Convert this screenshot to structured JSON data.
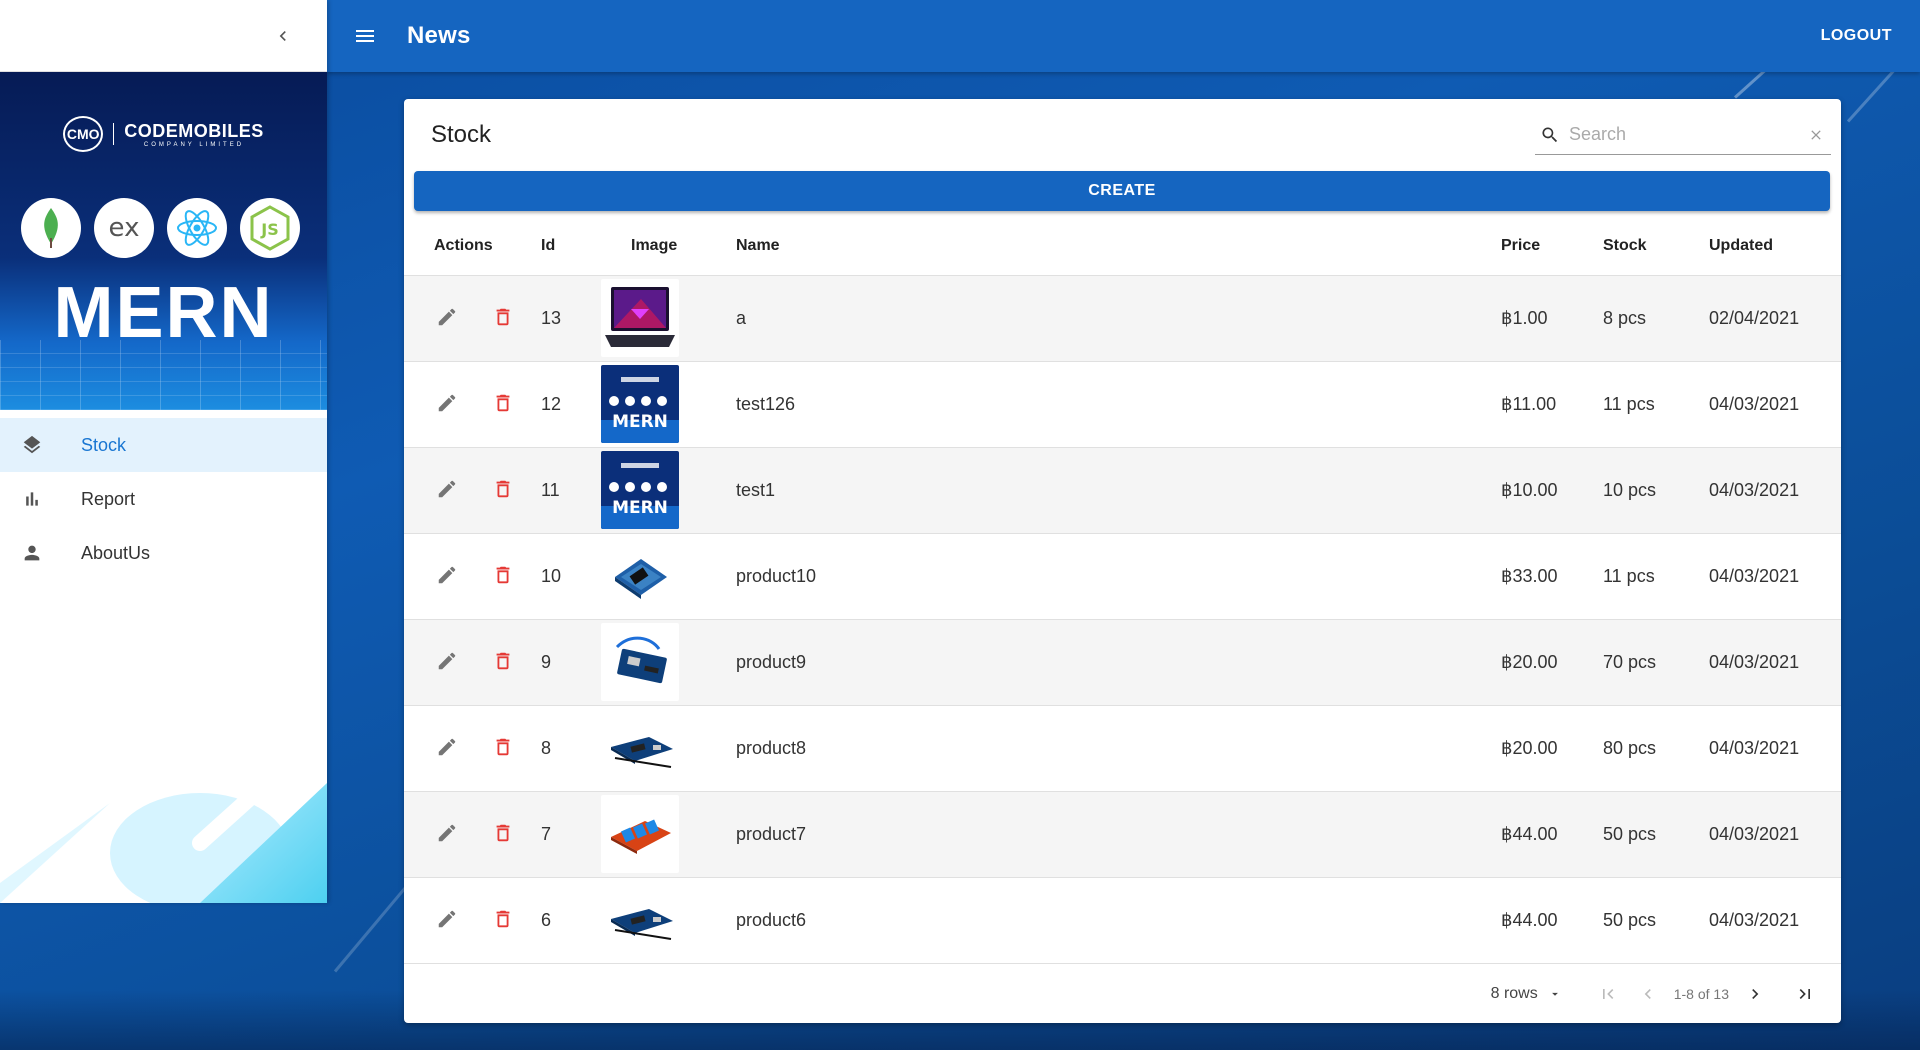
{
  "app": {
    "title": "News",
    "logout_label": "LOGOUT"
  },
  "drawer": {
    "brand": {
      "mark": "CMO",
      "name": "CODEMOBILES",
      "subtitle": "COMPANY LIMITED"
    },
    "banner_word": "MERN",
    "tech_icons": [
      "mongodb-icon",
      "express-icon",
      "react-icon",
      "nodejs-icon"
    ],
    "items": [
      {
        "label": "Stock",
        "icon": "layers-icon",
        "active": true
      },
      {
        "label": "Report",
        "icon": "bar-chart-icon",
        "active": false
      },
      {
        "label": "AboutUs",
        "icon": "person-icon",
        "active": false
      }
    ]
  },
  "stock": {
    "title": "Stock",
    "search": {
      "placeholder": "Search",
      "value": ""
    },
    "create_label": "CREATE",
    "columns": [
      "Actions",
      "Id",
      "Image",
      "Name",
      "Price",
      "Stock",
      "Updated"
    ],
    "rows": [
      {
        "id": "13",
        "image": "laptop",
        "name": "a",
        "price": "฿1.00",
        "stock": "8 pcs",
        "updated": "02/04/2021"
      },
      {
        "id": "12",
        "image": "mern-banner",
        "name": "test126",
        "price": "฿11.00",
        "stock": "11 pcs",
        "updated": "04/03/2021"
      },
      {
        "id": "11",
        "image": "mern-banner",
        "name": "test1",
        "price": "฿10.00",
        "stock": "10 pcs",
        "updated": "04/03/2021"
      },
      {
        "id": "10",
        "image": "sensor-shield",
        "name": "product10",
        "price": "฿33.00",
        "stock": "11 pcs",
        "updated": "04/03/2021"
      },
      {
        "id": "9",
        "image": "arduino-usb",
        "name": "product9",
        "price": "฿20.00",
        "stock": "70 pcs",
        "updated": "04/03/2021"
      },
      {
        "id": "8",
        "image": "arduino-board",
        "name": "product8",
        "price": "฿20.00",
        "stock": "80 pcs",
        "updated": "04/03/2021"
      },
      {
        "id": "7",
        "image": "relay-module",
        "name": "product7",
        "price": "฿44.00",
        "stock": "50 pcs",
        "updated": "04/03/2021"
      },
      {
        "id": "6",
        "image": "arduino-board",
        "name": "product6",
        "price": "฿44.00",
        "stock": "50 pcs",
        "updated": "04/03/2021"
      }
    ],
    "pagination": {
      "rows_per_page": "8 rows",
      "range": "1-8 of 13"
    }
  },
  "colors": {
    "primary": "#1565c0",
    "delete": "#e53935",
    "active_bg": "#e3f2fd",
    "active_text": "#1976d2"
  }
}
